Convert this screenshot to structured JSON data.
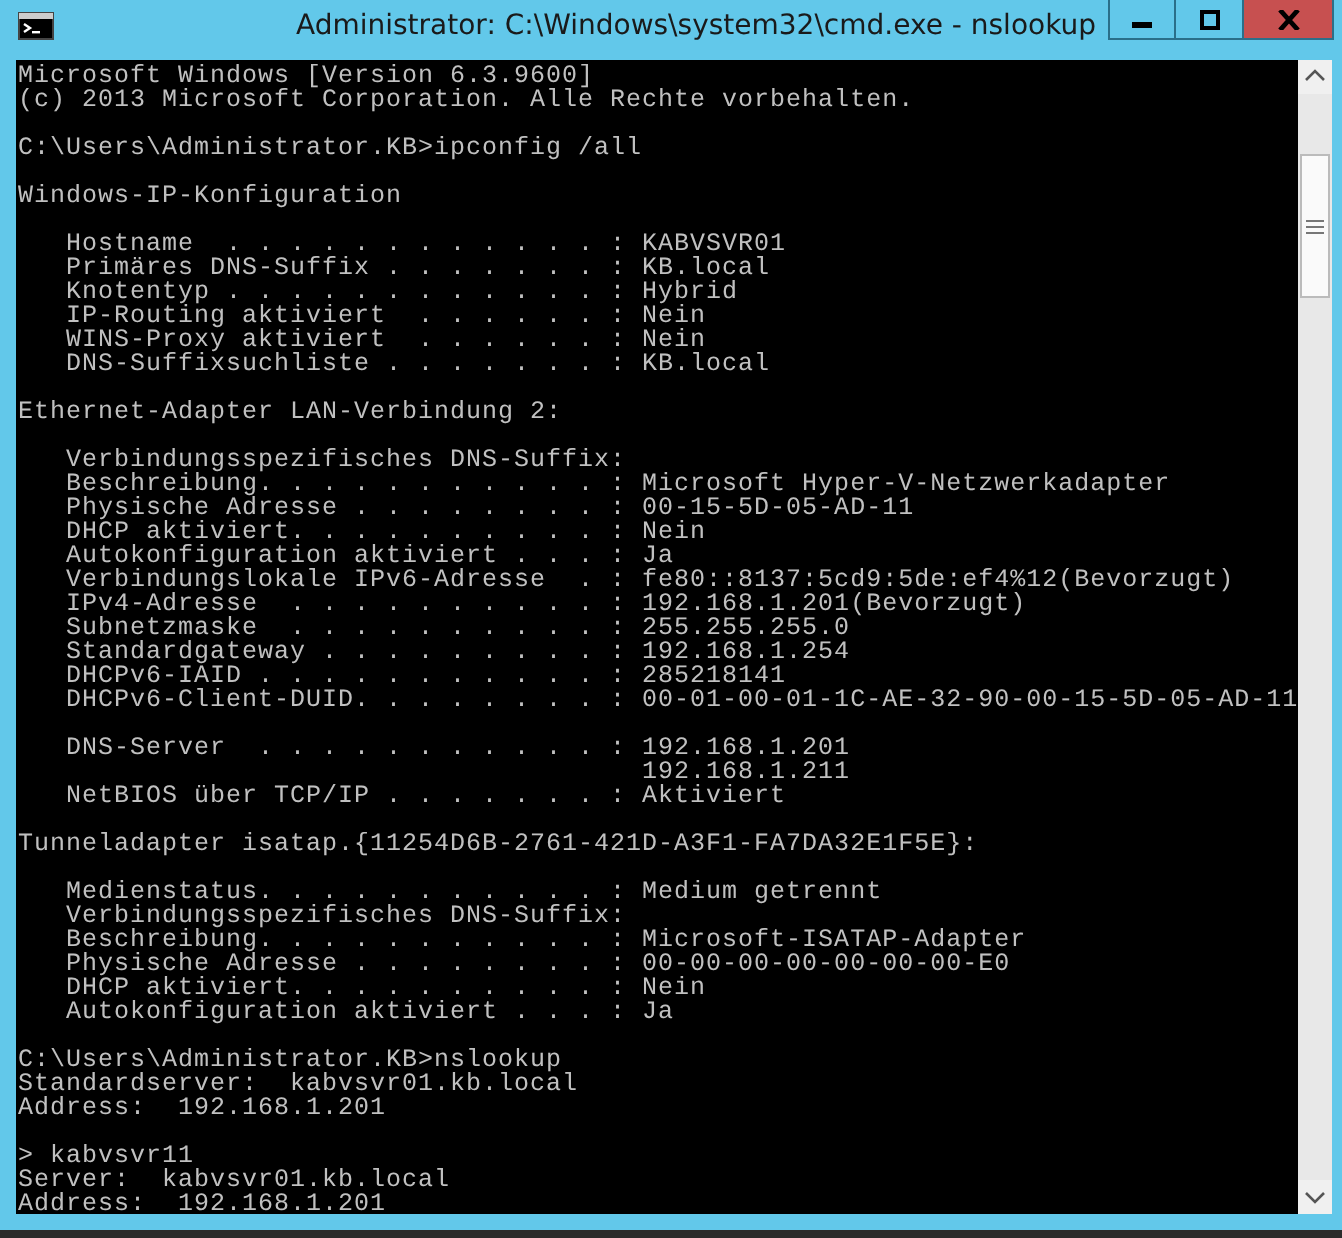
{
  "window": {
    "title": "Administrator: C:\\Windows\\system32\\cmd.exe - nslookup"
  },
  "console": {
    "blocks": [
      [
        "Microsoft Windows [Version 6.3.9600]",
        "(c) 2013 Microsoft Corporation. Alle Rechte vorbehalten."
      ],
      [
        "C:\\Users\\Administrator.KB>ipconfig /all"
      ],
      [
        "Windows-IP-Konfiguration"
      ],
      [
        "   Hostname  . . . . . . . . . . . . : KABVSVR01",
        "   Primäres DNS-Suffix . . . . . . . : KB.local",
        "   Knotentyp . . . . . . . . . . . . : Hybrid",
        "   IP-Routing aktiviert  . . . . . . : Nein",
        "   WINS-Proxy aktiviert  . . . . . . : Nein",
        "   DNS-Suffixsuchliste . . . . . . . : KB.local"
      ],
      [
        "Ethernet-Adapter LAN-Verbindung 2:"
      ],
      [
        "   Verbindungsspezifisches DNS-Suffix:",
        "   Beschreibung. . . . . . . . . . . : Microsoft Hyper-V-Netzwerkadapter",
        "   Physische Adresse . . . . . . . . : 00-15-5D-05-AD-11",
        "   DHCP aktiviert. . . . . . . . . . : Nein",
        "   Autokonfiguration aktiviert . . . : Ja",
        "   Verbindungslokale IPv6-Adresse  . : fe80::8137:5cd9:5de:ef4%12(Bevorzugt)",
        "   IPv4-Adresse  . . . . . . . . . . : 192.168.1.201(Bevorzugt)",
        "   Subnetzmaske  . . . . . . . . . . : 255.255.255.0",
        "   Standardgateway . . . . . . . . . : 192.168.1.254",
        "   DHCPv6-IAID . . . . . . . . . . . : 285218141",
        "   DHCPv6-Client-DUID. . . . . . . . : 00-01-00-01-1C-AE-32-90-00-15-5D-05-AD-11"
      ],
      [
        "   DNS-Server  . . . . . . . . . . . : 192.168.1.201",
        "                                       192.168.1.211",
        "   NetBIOS über TCP/IP . . . . . . . : Aktiviert"
      ],
      [
        "Tunneladapter isatap.{11254D6B-2761-421D-A3F1-FA7DA32E1F5E}:"
      ],
      [
        "   Medienstatus. . . . . . . . . . . : Medium getrennt",
        "   Verbindungsspezifisches DNS-Suffix:",
        "   Beschreibung. . . . . . . . . . . : Microsoft-ISATAP-Adapter",
        "   Physische Adresse . . . . . . . . : 00-00-00-00-00-00-00-E0",
        "   DHCP aktiviert. . . . . . . . . . : Nein",
        "   Autokonfiguration aktiviert . . . : Ja"
      ],
      [
        "C:\\Users\\Administrator.KB>nslookup",
        "Standardserver:  kabvsvr01.kb.local",
        "Address:  192.168.1.201"
      ],
      [
        "> kabvsvr11",
        "Server:  kabvsvr01.kb.local",
        "Address:  192.168.1.201"
      ]
    ]
  }
}
